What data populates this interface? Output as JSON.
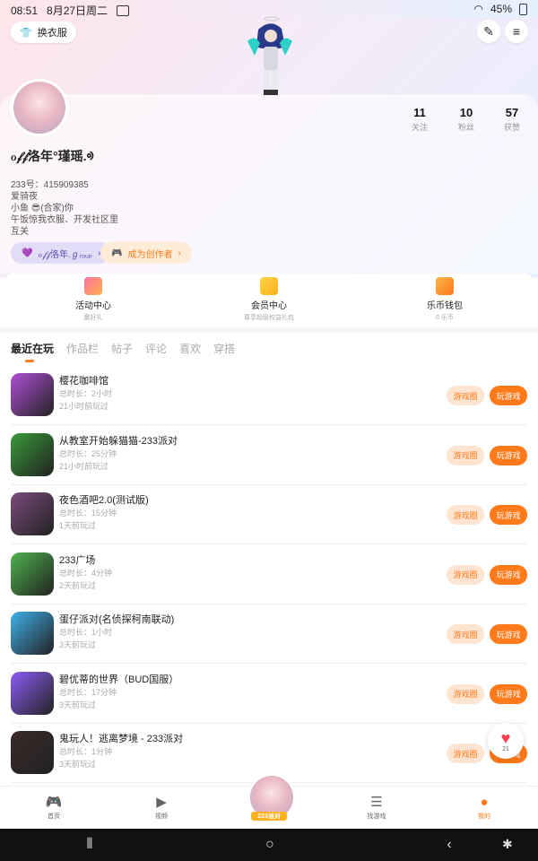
{
  "status": {
    "time": "08:51",
    "date": "8月27日周二",
    "battery": "45%"
  },
  "header": {
    "outfit_button": "换衣服",
    "stats": [
      {
        "num": "11",
        "label": "关注"
      },
      {
        "num": "10",
        "label": "粉丝"
      },
      {
        "num": "57",
        "label": "获赞"
      }
    ]
  },
  "profile": {
    "nickname": "ℴ𝒻𝒻洛年°瑾瑶.ᢀ",
    "uid": "233号：415909385",
    "bio": [
      "爱骑夜",
      "小鱼 😎(合家)你",
      "午饭惊我衣服、开发社区里",
      "互关"
    ],
    "tag_purple": "ℴ𝒻𝒻洛年.ℊᵣₒᵤₚ",
    "tag_orange": "成为创作者"
  },
  "entries": [
    {
      "title": "活动中心",
      "sub": "赢好礼"
    },
    {
      "title": "会员中心",
      "sub": "尊享超级权益礼包"
    },
    {
      "title": "乐币钱包",
      "sub": "0 乐币"
    }
  ],
  "tabs": [
    "最近在玩",
    "作品栏",
    "帖子",
    "评论",
    "喜欢",
    "穿搭"
  ],
  "games": [
    {
      "name": "樱花咖啡馆",
      "duration": "总时长：2小时",
      "last": "21小时前玩过",
      "color": "#b04fd6"
    },
    {
      "name": "从教室开始躲猫猫-233派对",
      "duration": "总时长：25分钟",
      "last": "21小时前玩过",
      "color": "#3a9a3a"
    },
    {
      "name": "夜色酒吧2.0(测试版)",
      "duration": "总时长：15分钟",
      "last": "1天前玩过",
      "color": "#7a4b7a"
    },
    {
      "name": "233广场",
      "duration": "总时长：4分钟",
      "last": "2天前玩过",
      "color": "#4fb34f"
    },
    {
      "name": "蛋仔派对(名侦探柯南联动)",
      "duration": "总时长：1小时",
      "last": "3天前玩过",
      "color": "#3fb0e8"
    },
    {
      "name": "碧优蒂的世界（BUD国服）",
      "duration": "总时长：17分钟",
      "last": "3天前玩过",
      "color": "#8c5cf5"
    },
    {
      "name": "鬼玩人！逃离梦境 - 233派对",
      "duration": "总时长：1分钟",
      "last": "3天前玩过",
      "color": "#3a2a2a"
    }
  ],
  "game_buttons": {
    "circle": "游戏圈",
    "play": "玩游戏"
  },
  "float": {
    "count": "21"
  },
  "nav": [
    {
      "label": "首页",
      "icon": "gamepad-icon"
    },
    {
      "label": "视频",
      "icon": "video-icon"
    },
    {
      "label": "233派对",
      "icon": "party-avatar"
    },
    {
      "label": "找游戏",
      "icon": "list-icon"
    },
    {
      "label": "我的",
      "icon": "profile-icon"
    }
  ]
}
